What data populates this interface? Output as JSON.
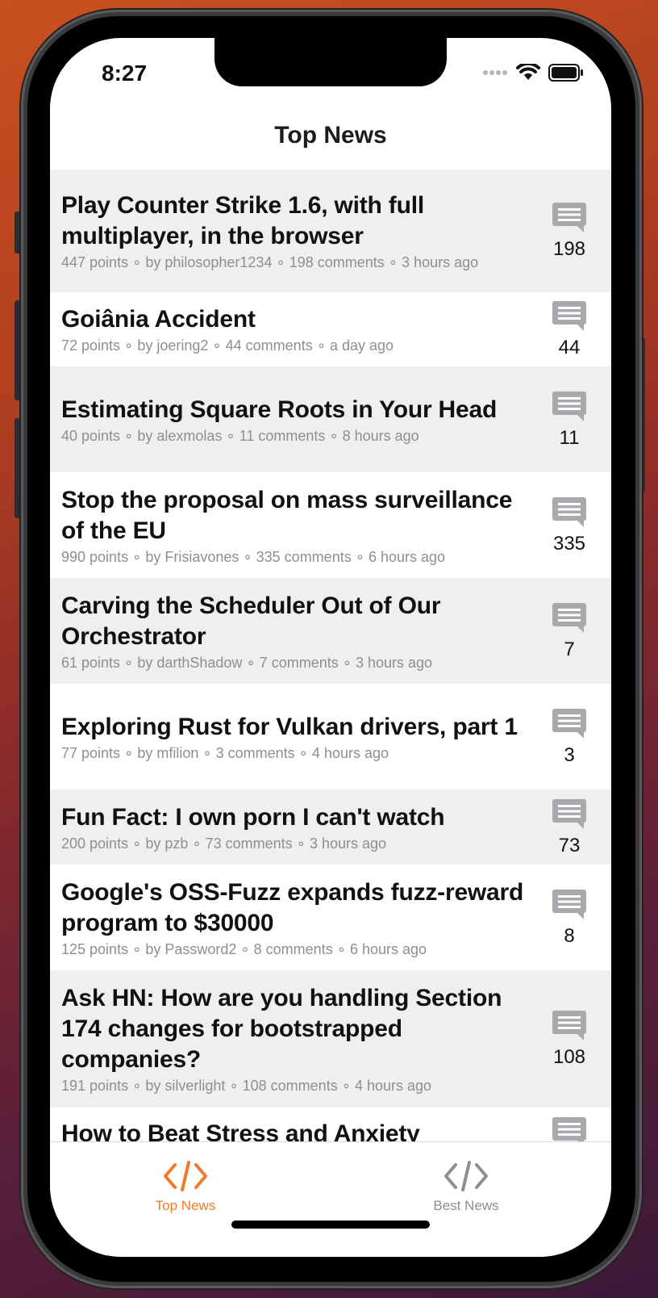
{
  "status_bar": {
    "time": "8:27"
  },
  "nav": {
    "title": "Top News"
  },
  "colors": {
    "accent": "#f07a2a",
    "inactive": "#8e8e93",
    "row_shaded": "#efeff0"
  },
  "stories": [
    {
      "title": "Play Counter Strike 1.6, with full multiplayer, in the browser",
      "meta": "447 points ∘ by philosopher1234 ∘ 198 comments ∘ 3 hours ago",
      "comment_count": "198"
    },
    {
      "title": "Goiânia Accident",
      "meta": "72 points ∘ by joering2 ∘ 44 comments ∘ a day ago",
      "comment_count": "44"
    },
    {
      "title": "Estimating Square Roots in Your Head",
      "meta": "40 points ∘ by alexmolas ∘ 11 comments ∘ 8 hours ago",
      "comment_count": "11"
    },
    {
      "title": "Stop the proposal on mass surveillance of the EU",
      "meta": "990 points ∘ by Frisiavones ∘ 335 comments ∘ 6 hours ago",
      "comment_count": "335"
    },
    {
      "title": "Carving the Scheduler Out of Our Orchestrator",
      "meta": "61 points ∘ by darthShadow ∘ 7 comments ∘ 3 hours ago",
      "comment_count": "7"
    },
    {
      "title": "Exploring Rust for Vulkan drivers, part 1",
      "meta": "77 points ∘ by mfilion ∘ 3 comments ∘ 4 hours ago",
      "comment_count": "3"
    },
    {
      "title": "Fun Fact: I own porn I can't watch",
      "meta": "200 points ∘ by pzb ∘ 73 comments ∘ 3 hours ago",
      "comment_count": "73"
    },
    {
      "title": "Google's OSS-Fuzz expands fuzz-reward program to $30000",
      "meta": "125 points ∘ by Password2 ∘ 8 comments ∘ 6 hours ago",
      "comment_count": "8"
    },
    {
      "title": "Ask HN: How are you handling Section 174 changes for bootstrapped companies?",
      "meta": "191 points ∘ by silverlight ∘ 108 comments ∘ 4 hours ago",
      "comment_count": "108"
    },
    {
      "title": "How to Beat Stress and Anxiety",
      "meta": "",
      "comment_count": ""
    }
  ],
  "tabs": [
    {
      "label": "Top News",
      "icon": "code-icon",
      "selected": true
    },
    {
      "label": "Best News",
      "icon": "code-icon",
      "selected": false
    }
  ]
}
